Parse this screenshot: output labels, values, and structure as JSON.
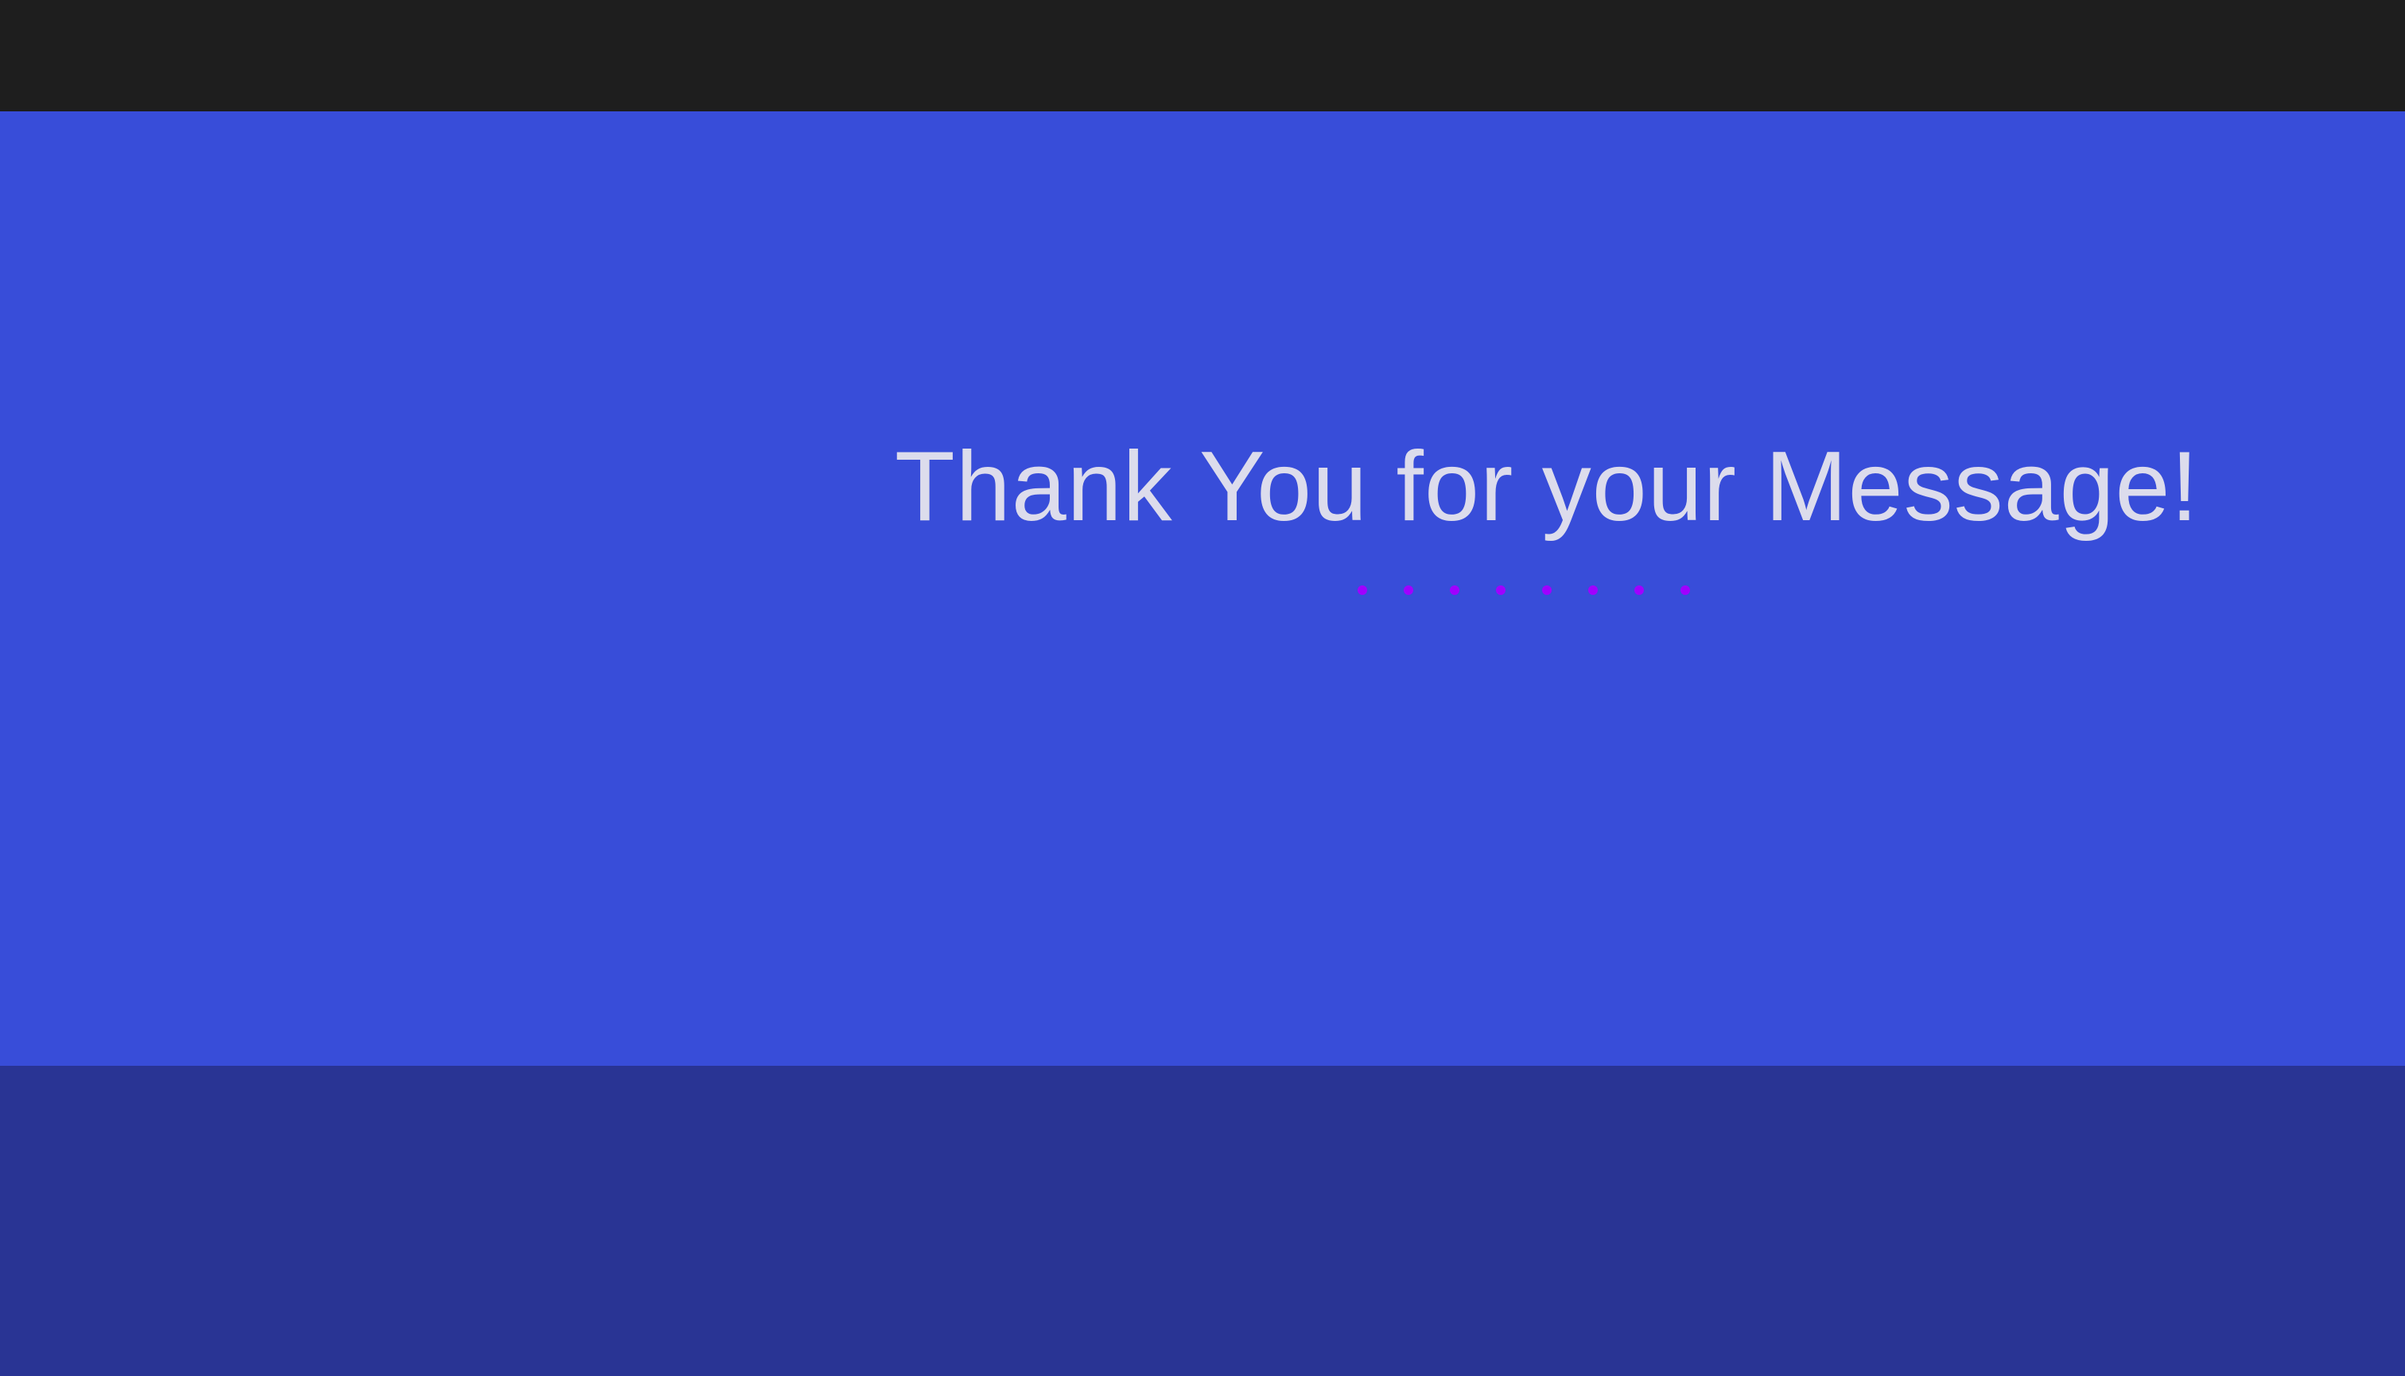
{
  "top_bar": {},
  "hero": {
    "title": "Thank You for your Message!",
    "divider": {
      "dot_count": 8,
      "dot_color": "#a000ff"
    }
  },
  "colors": {
    "top_bar": "#1e1e1e",
    "hero_background": "#384dd9",
    "title_text": "#dcdcec",
    "footer_background": "#293494"
  },
  "footer": {}
}
